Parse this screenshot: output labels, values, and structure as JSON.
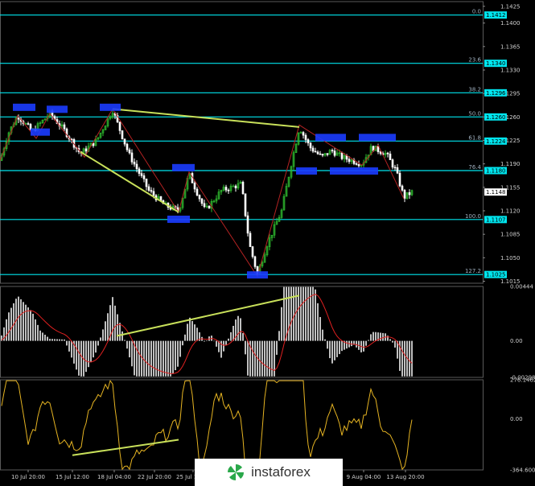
{
  "chart_data": [
    {
      "type": "candlestick",
      "ylim": [
        1.1012,
        1.1432
      ],
      "y_ticks": [
        1.1425,
        1.14,
        1.1365,
        1.133,
        1.1295,
        1.126,
        1.1225,
        1.119,
        1.1155,
        1.112,
        1.1085,
        1.105,
        1.1015
      ],
      "x_tick_labels": [
        "10 Jul 20:00",
        "15 Jul 12:00",
        "18 Jul 04:00",
        "22 Jul 20:00",
        "25 Jul 12:00",
        "9 Aug 04:00",
        "13 Aug 20:00"
      ],
      "last_price": 1.1148,
      "fib_levels": [
        {
          "ratio": "0.0",
          "price": 1.1412
        },
        {
          "ratio": "23.6",
          "price": 1.134
        },
        {
          "ratio": "38.2",
          "price": 1.1296
        },
        {
          "ratio": "50.0",
          "price": 1.126
        },
        {
          "ratio": "61.8",
          "price": 1.1224
        },
        {
          "ratio": "76.4",
          "price": 1.118
        },
        {
          "ratio": "100.0",
          "price": 1.1107
        },
        {
          "ratio": "127.2",
          "price": 1.1025
        }
      ]
    },
    {
      "type": "bar",
      "ylim": [
        -0.00298,
        0.00444
      ],
      "y_ticks": [
        "0.00444",
        "0.00",
        "-0.00298"
      ]
    },
    {
      "type": "line",
      "ylim": [
        -364.6,
        276.1462
      ],
      "y_ticks": [
        "276.1462",
        "0.00",
        "-364.6000"
      ]
    }
  ],
  "watermark": {
    "brand": "instaforex"
  },
  "colors": {
    "background": "#000000",
    "fib_line": "#00e5ee",
    "bull_candle": "#2fbf2f",
    "bear_candle": "#ffffff",
    "zigzag": "#b22222",
    "trend_line": "#c8e05a",
    "highlight_box": "#1b3cff",
    "signal_line": "#e02020",
    "oscillator_line": "#e6b422",
    "histogram": "#c0c0c0"
  }
}
